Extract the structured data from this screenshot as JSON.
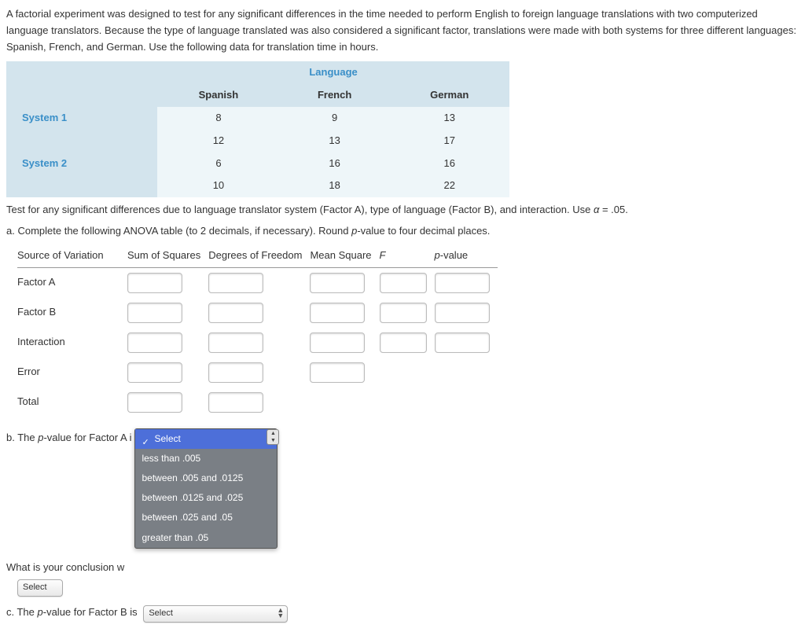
{
  "intro": "A factorial experiment was designed to test for any significant differences in the time needed to perform English to foreign language translations with two computerized language translators. Because the type of language translated was also considered a significant factor, translations were made with both systems for three different languages: Spanish, French, and German. Use the following data for translation time in hours.",
  "dataTable": {
    "superHeader": "Language",
    "colHeaders": [
      "Spanish",
      "French",
      "German"
    ],
    "rows": [
      {
        "label": "System 1",
        "vals": [
          "8",
          "9",
          "13"
        ]
      },
      {
        "label": "",
        "vals": [
          "12",
          "13",
          "17"
        ]
      },
      {
        "label": "System 2",
        "vals": [
          "6",
          "16",
          "16"
        ]
      },
      {
        "label": "",
        "vals": [
          "10",
          "18",
          "22"
        ]
      }
    ]
  },
  "instr1_a": "Test for any significant differences due to language translator system (Factor A), type of language (Factor B), and interaction. Use ",
  "instr1_b": " = .05.",
  "alpha_sym": "α",
  "partA": "a. Complete the following ANOVA table (to 2 decimals, if necessary). Round ",
  "partA_pv": "p",
  "partA_end": "-value to four decimal places.",
  "anovaHeaders": [
    "Source of Variation",
    "Sum of Squares",
    "Degrees of Freedom",
    "Mean Square",
    "F",
    "p-value"
  ],
  "anovaRows": [
    "Factor A",
    "Factor B",
    "Interaction",
    "Error",
    "Total"
  ],
  "partB_prefix": "b. The ",
  "partB_pv": "p",
  "partB_mid": "-value for Factor A i",
  "dropdown": {
    "selected": "Select",
    "options": [
      "less than .005",
      "between .005 and .0125",
      "between .0125 and .025",
      "between .025 and .05",
      "greater than .05"
    ]
  },
  "conclusion_q": "What is your conclusion w",
  "select_label": "Select",
  "partC_prefix": "c. The ",
  "partC_pv": "p",
  "partC_mid": "-value for Factor B is"
}
